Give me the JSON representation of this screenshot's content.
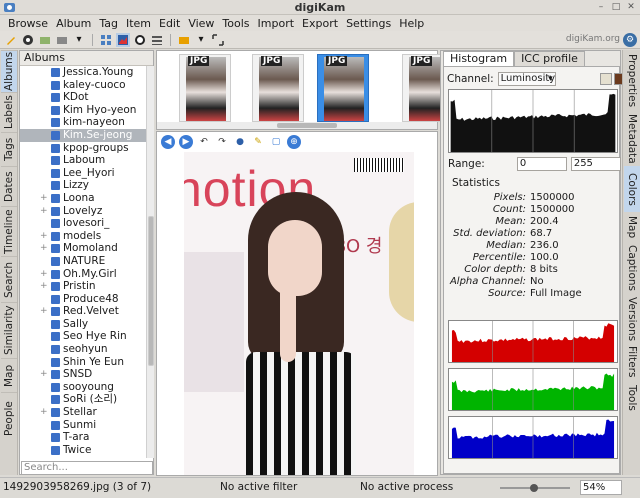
{
  "window": {
    "title": "digiKam"
  },
  "menu": [
    "Browse",
    "Album",
    "Tag",
    "Item",
    "Edit",
    "View",
    "Tools",
    "Import",
    "Export",
    "Settings",
    "Help"
  ],
  "toolbar": {
    "brand": "digiKam.org"
  },
  "left_tabs": [
    "Albums",
    "Labels",
    "Tags",
    "Dates",
    "Timeline",
    "Search",
    "Similarity",
    "Map",
    "People"
  ],
  "right_tabs": [
    "Properties",
    "Metadata",
    "Colors",
    "Map",
    "Captions",
    "Versions",
    "Filters",
    "Tools"
  ],
  "albums": {
    "header": "Albums",
    "selected": "Kim.Se-jeong",
    "items": [
      "Jessica.Young",
      "kaley-cuoco",
      "KDot",
      "Kim Hyo-yeon",
      "kim-nayeon",
      "Kim.Se-jeong",
      "kpop-groups",
      "Laboum",
      "Lee_Hyori",
      "Lizzy",
      "Loona",
      "Lovelyz",
      "lovesori_",
      "models",
      "Momoland",
      "NATURE",
      "Oh.My.Girl",
      "Pristin",
      "Produce48",
      "Red.Velvet",
      "Sally",
      "Seo Hye Rin",
      "seohyun",
      "Shin Ye Eun",
      "SNSD",
      "sooyoung",
      "SoRi (소리)",
      "Stellar",
      "Sunmi",
      "T-ara",
      "Twice"
    ],
    "expandable": [
      "Loona",
      "Lovelyz",
      "models",
      "Momoland",
      "Oh.My.Girl",
      "Pristin",
      "Red.Velvet",
      "SNSD",
      "Stellar"
    ],
    "search_placeholder": "Search..."
  },
  "thumbnails": [
    {
      "badge": "JPG",
      "selected": false
    },
    {
      "badge": "JPG",
      "selected": false
    },
    {
      "badge": "JPG",
      "selected": true
    },
    {
      "badge": "JPG",
      "selected": false
    }
  ],
  "preview": {
    "banner_text": "notion",
    "sign_text": "BO   경 표"
  },
  "right_panel": {
    "tabs": [
      "Histogram",
      "ICC profile"
    ],
    "channel_label": "Channel:",
    "channel_value": "Luminosity",
    "range_label": "Range:",
    "range_min": "0",
    "range_max": "255",
    "statistics_title": "Statistics",
    "stats": [
      {
        "key": "Pixels:",
        "value": "1500000"
      },
      {
        "key": "Count:",
        "value": "1500000"
      },
      {
        "key": "Mean:",
        "value": "200.4"
      },
      {
        "key": "Std. deviation:",
        "value": "68.7"
      },
      {
        "key": "Median:",
        "value": "236.0"
      },
      {
        "key": "Percentile:",
        "value": "100.0"
      },
      {
        "key": "Color depth:",
        "value": "8 bits"
      },
      {
        "key": "Alpha Channel:",
        "value": "No"
      },
      {
        "key": "Source:",
        "value": "Full Image"
      }
    ],
    "colors": {
      "red": "#d40000",
      "green": "#00b400",
      "blue": "#0000c8"
    }
  },
  "statusbar": {
    "file": "1492903958269.jpg (3 of 7)",
    "filter": "No active filter",
    "process": "No active process",
    "zoom": "54%"
  }
}
